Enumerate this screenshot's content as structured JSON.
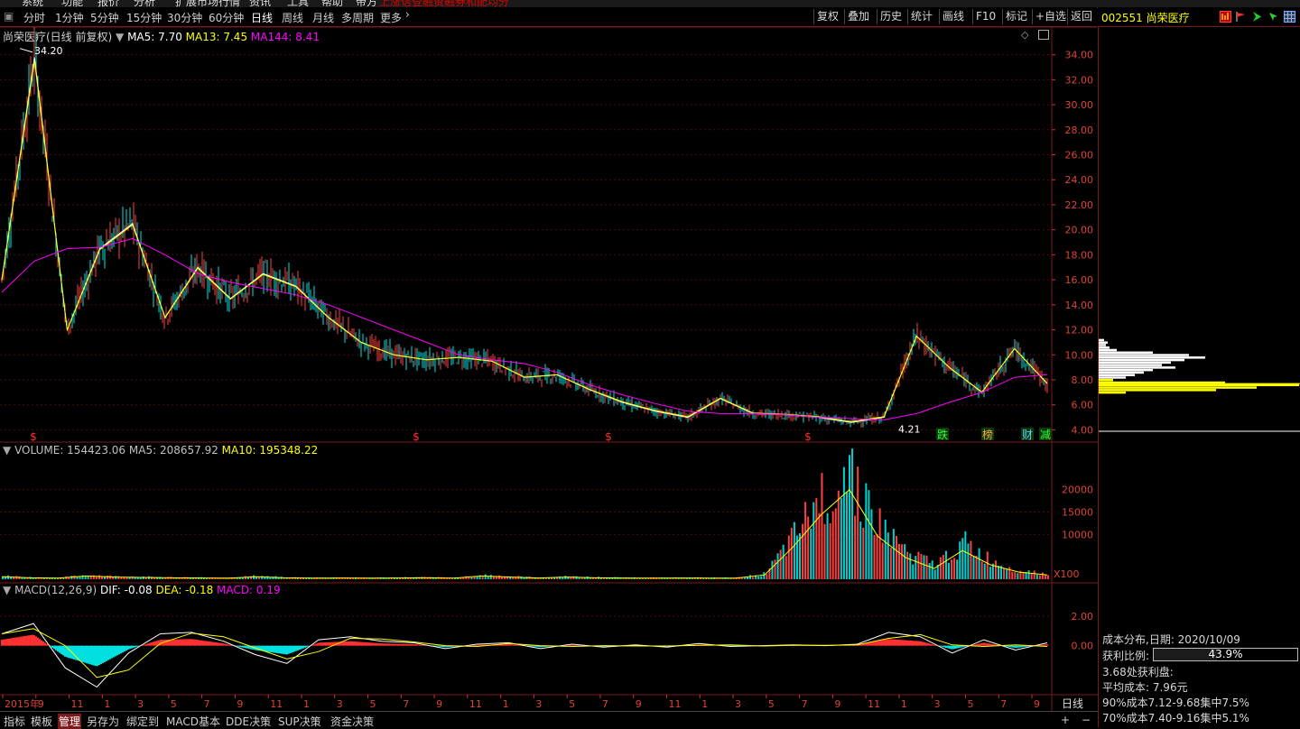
{
  "top_menu": [
    "系统",
    "功能",
    "报价",
    "分析",
    "扩展市场行情",
    "资讯",
    "工具",
    "帮助",
    "带方",
    "上涨信登融资融券和配均分"
  ],
  "toolbar": {
    "periods": [
      "分时",
      "1分钟",
      "5分钟",
      "15分钟",
      "30分钟",
      "60分钟",
      "日线",
      "周线",
      "月线",
      "多周期",
      "更多"
    ],
    "active_period": "日线",
    "right_buttons": [
      "复权",
      "叠加",
      "历史",
      "统计",
      "画线",
      "F10",
      "标记",
      "+自选",
      "返回"
    ]
  },
  "stock": {
    "code": "002551",
    "name": "尚荣医疗"
  },
  "price_panel": {
    "title": "尚荣医疗(日线 前复权)",
    "ma_labels": [
      {
        "text": "MA5: 7.70",
        "color": "#ffffff"
      },
      {
        "text": "MA13: 7.45",
        "color": "#ffff00"
      },
      {
        "text": "MA144: 8.41",
        "color": "#ff00ff"
      }
    ],
    "high_label": "34.20",
    "low_label": "4.21",
    "event_marks": [
      "跌",
      "榜",
      "财",
      "减"
    ],
    "dividend_mark": "$"
  },
  "volume_panel": {
    "legend": [
      {
        "text": "VOLUME: 154423.06",
        "color": "#c0c0c0"
      },
      {
        "text": "MA5: 208657.92",
        "color": "#c0c0c0"
      },
      {
        "text": "MA10: 195348.22",
        "color": "#ffff00"
      }
    ],
    "unit": "X100"
  },
  "macd_panel": {
    "legend": [
      {
        "text": "MACD(12,26,9)",
        "color": "#c0c0c0"
      },
      {
        "text": "DIF: -0.08",
        "color": "#ffffff"
      },
      {
        "text": "DEA: -0.18",
        "color": "#ffff00"
      },
      {
        "text": "MACD: 0.19",
        "color": "#ff00ff"
      }
    ]
  },
  "time_axis": {
    "labels": [
      "2015年",
      "9",
      "11",
      "1",
      "3",
      "5",
      "7",
      "9",
      "11",
      "1",
      "3",
      "5",
      "7",
      "9",
      "11",
      "1",
      "3",
      "5",
      "7",
      "9",
      "11",
      "1",
      "3",
      "5",
      "7",
      "9",
      "11",
      "1",
      "3",
      "5",
      "7",
      "9"
    ],
    "current_period": "日线"
  },
  "bottom_tabs": {
    "items": [
      "指标",
      "模板",
      "管理",
      "另存为",
      "绑定到",
      "MACD基本",
      "DDE决策",
      "SUP决策",
      "资金决策"
    ],
    "active": "管理",
    "zoom_plus": "+",
    "zoom_minus": "−"
  },
  "chip_distribution": {
    "title": "成本分布,日期: 2020/10/09",
    "profit_label": "获利比例:",
    "profit_ratio": "43.9%",
    "profit_value": 0.439,
    "profit_at": "3.68处获利盘:",
    "avg_cost": "平均成本: 7.96元",
    "cost90": "90%成本7.12-9.68集中7.5%",
    "cost70": "70%成本7.40-9.16集中5.1%"
  },
  "chart_data": [
    {
      "type": "line",
      "title": "尚荣医疗(日线 前复权)",
      "y_ticks": [
        4.0,
        6.0,
        8.0,
        10.0,
        12.0,
        14.0,
        16.0,
        18.0,
        20.0,
        22.0,
        24.0,
        26.0,
        28.0,
        30.0,
        32.0,
        34.0
      ],
      "ylim": [
        3.6,
        35.2
      ],
      "x_months": [
        "2015-07",
        "2015-09",
        "2015-11",
        "2016-01",
        "2016-03",
        "2016-05",
        "2016-07",
        "2016-09",
        "2016-11",
        "2017-01",
        "2017-03",
        "2017-05",
        "2017-07",
        "2017-09",
        "2017-11",
        "2018-01",
        "2018-03",
        "2018-05",
        "2018-07",
        "2018-09",
        "2018-11",
        "2019-01",
        "2019-03",
        "2019-05",
        "2019-07",
        "2019-09",
        "2019-11",
        "2020-01",
        "2020-03",
        "2020-05",
        "2020-07",
        "2020-09",
        "2020-10"
      ],
      "series": [
        {
          "name": "MA5",
          "values": [
            16,
            33.8,
            12,
            18.5,
            20.5,
            13,
            17,
            14.5,
            16.5,
            15.5,
            13,
            11,
            10,
            9.6,
            9.8,
            9.5,
            8.2,
            8.4,
            7.2,
            6.2,
            5.5,
            5,
            6.5,
            5.3,
            5.2,
            5,
            4.6,
            5,
            11.5,
            9,
            7,
            10.5,
            7.7
          ]
        },
        {
          "name": "MA144",
          "values": [
            15,
            17.5,
            18.5,
            18.6,
            19.3,
            18,
            16.5,
            15.8,
            15.3,
            14.8,
            14,
            13,
            12,
            11,
            10,
            9.6,
            9.3,
            8.6,
            7.6,
            6.8,
            6.1,
            5.5,
            5.3,
            5.3,
            5.2,
            5.0,
            4.9,
            4.8,
            5.3,
            6.2,
            7.0,
            8.2,
            8.41
          ]
        }
      ]
    },
    {
      "type": "bar",
      "title": "VOLUME",
      "y_ticks": [
        10000,
        15000,
        20000
      ],
      "ylim": [
        0,
        27000
      ],
      "values": [
        700,
        400,
        300,
        900,
        600,
        500,
        400,
        350,
        300,
        700,
        400,
        300,
        350,
        300,
        350,
        400,
        300,
        900,
        600,
        350,
        600,
        400,
        350,
        300,
        350,
        300,
        300,
        1200,
        9000,
        18000,
        25000,
        12000,
        6000,
        3000,
        8000,
        4000,
        2000,
        1200
      ]
    },
    {
      "type": "bar",
      "title": "MACD(12,26,9)",
      "y_ticks": [
        0.0,
        2.0
      ],
      "ylim": [
        -3.2,
        3.4
      ],
      "values": [
        0.8,
        1.5,
        -1.5,
        -2.8,
        -0.5,
        0.8,
        0.9,
        0.3,
        -0.6,
        -1.2,
        0.4,
        0.6,
        0.3,
        0.2,
        -0.2,
        0.1,
        0.2,
        -0.2,
        0.1,
        -0.1,
        0.05,
        -0.1,
        0.15,
        -0.05,
        0.0,
        0.05,
        0.0,
        0.1,
        0.9,
        0.6,
        -0.5,
        0.4,
        -0.3,
        0.19
      ]
    }
  ]
}
